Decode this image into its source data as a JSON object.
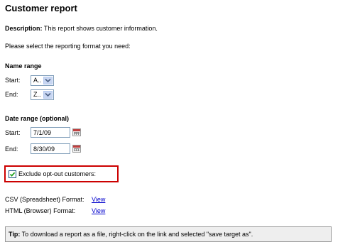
{
  "page": {
    "title": "Customer report",
    "description_label": "Description:",
    "description_text": " This report shows customer information.",
    "prompt": "Please select the reporting format you need:"
  },
  "name_range": {
    "heading": "Name range",
    "start_label": "Start:",
    "start_value": "A..",
    "end_label": "End:",
    "end_value": "Z.."
  },
  "date_range": {
    "heading": "Date range (optional)",
    "start_label": "Start:",
    "start_value": "7/1/09",
    "end_label": "End:",
    "end_value": "8/30/09"
  },
  "options": {
    "exclude_label": "Exclude opt-out customers:",
    "exclude_checked": true
  },
  "formats": {
    "csv_label": "CSV (Spreadsheet) Format:",
    "csv_link": "View",
    "html_label": "HTML (Browser) Format:",
    "html_link": "View"
  },
  "tip": {
    "label": "Tip:",
    "text": " To download a report as a file, right-click on the link and selected \"save target as\"."
  },
  "colors": {
    "highlight_border": "#cc0000",
    "link": "#0000cc",
    "tip_background": "#eeeeee"
  },
  "icons": [
    "chevron-down-icon",
    "calendar-icon",
    "checkmark-icon"
  ]
}
